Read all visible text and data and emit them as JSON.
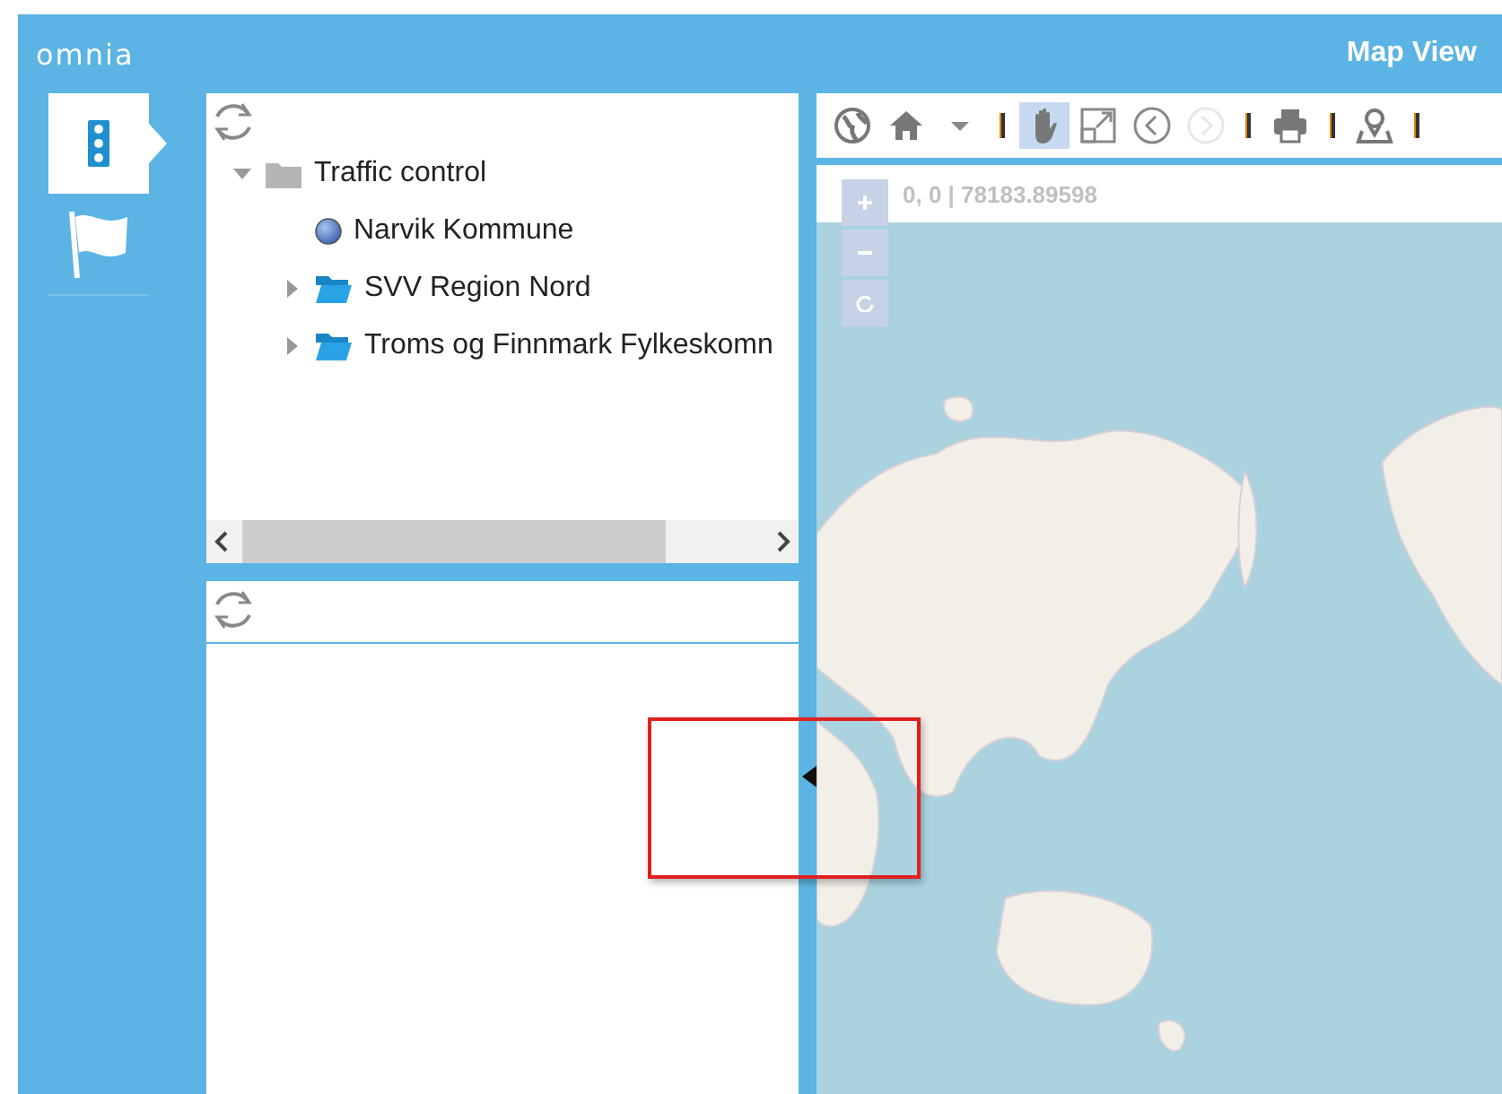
{
  "header": {
    "logo": "omnia",
    "title": "Map View"
  },
  "sidebar_tabs": [
    {
      "kind": "traffic-light",
      "selected": true
    },
    {
      "kind": "flag",
      "selected": false
    }
  ],
  "tree": {
    "items": [
      {
        "label": "Traffic control",
        "kind": "folder",
        "expanded": true,
        "children": [
          {
            "label": "Narvik Kommune",
            "kind": "layer"
          },
          {
            "label": "SVV Region Nord",
            "kind": "folder",
            "expanded": false
          },
          {
            "label": "Troms og Finnmark Fylkeskomn",
            "kind": "folder",
            "expanded": false
          }
        ]
      }
    ]
  },
  "toolbar": [
    {
      "kind": "globe",
      "selected": false,
      "disabled": false
    },
    {
      "kind": "home",
      "selected": false,
      "disabled": false
    },
    {
      "kind": "caret",
      "selected": false,
      "disabled": false
    },
    {
      "kind": "separator"
    },
    {
      "kind": "hand",
      "selected": true,
      "disabled": false
    },
    {
      "kind": "extent",
      "selected": false,
      "disabled": false
    },
    {
      "kind": "back",
      "selected": false,
      "disabled": false
    },
    {
      "kind": "forward",
      "selected": false,
      "disabled": true
    },
    {
      "kind": "separator"
    },
    {
      "kind": "print",
      "selected": false,
      "disabled": false
    },
    {
      "kind": "separator"
    },
    {
      "kind": "marker",
      "selected": false,
      "disabled": false
    },
    {
      "kind": "separator"
    }
  ],
  "map": {
    "coordinates": "0, 0 | 78183.89598",
    "zoom_controls": [
      {
        "kind": "plus"
      },
      {
        "kind": "minus"
      },
      {
        "kind": "reset"
      }
    ]
  }
}
